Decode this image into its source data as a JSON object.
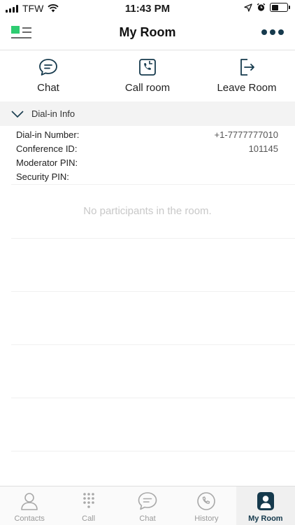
{
  "status_bar": {
    "carrier": "TFW",
    "time": "11:43 PM"
  },
  "header": {
    "title": "My Room",
    "menu_icon": "sidebar-menu-icon",
    "more_icon": "more-dots-icon"
  },
  "actions": [
    {
      "label": "Chat",
      "icon": "chat-bubble-icon"
    },
    {
      "label": "Call room",
      "icon": "phone-call-icon"
    },
    {
      "label": "Leave Room",
      "icon": "leave-room-icon"
    }
  ],
  "dial_in": {
    "section_label": "Dial-in Info",
    "rows": [
      {
        "key": "Dial-in Number:",
        "value": "+1-7777777010"
      },
      {
        "key": "Conference ID:",
        "value": "101145"
      },
      {
        "key": "Moderator PIN:",
        "value": ""
      },
      {
        "key": "Security PIN:",
        "value": ""
      }
    ]
  },
  "participants": {
    "empty_message": "No participants in the room."
  },
  "tabs": [
    {
      "label": "Contacts",
      "icon": "contacts-icon",
      "active": false
    },
    {
      "label": "Call",
      "icon": "dialpad-icon",
      "active": false
    },
    {
      "label": "Chat",
      "icon": "chat-icon",
      "active": false
    },
    {
      "label": "History",
      "icon": "history-icon",
      "active": false
    },
    {
      "label": "My Room",
      "icon": "my-room-icon",
      "active": true
    }
  ],
  "colors": {
    "accent": "#163a4d",
    "brand_green": "#2ecc71",
    "muted": "#9a9a9a"
  }
}
